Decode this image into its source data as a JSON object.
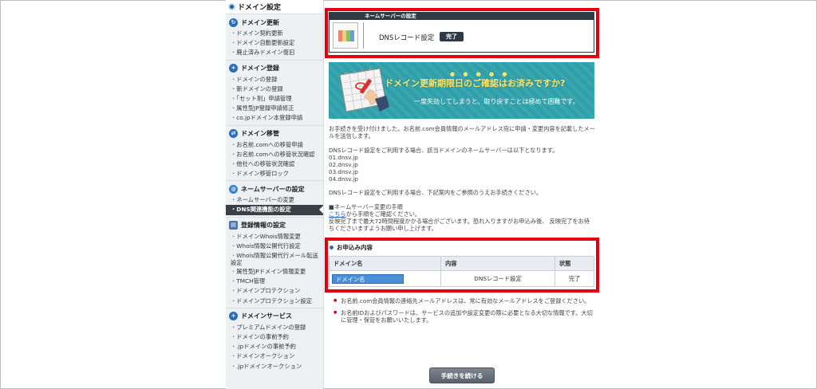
{
  "sidebar": {
    "title": "ドメイン設定",
    "sections": [
      {
        "name": "ドメイン更新",
        "items": [
          "ドメイン契約更新",
          "ドメイン自動更新設定",
          "廃止済みドメイン復旧"
        ]
      },
      {
        "name": "ドメイン登録",
        "items": [
          "ドメインの登録",
          "新ドメインの登録",
          "「セット割」申請管理",
          "属性型JP登録申請修正",
          "co.jpドメイン本登録申請"
        ]
      },
      {
        "name": "ドメイン移管",
        "items": [
          "お名前.comへの移管申請",
          "お名前.comへの移管状況確認",
          "他社への移管状況確認",
          "ドメイン移管ロック"
        ]
      },
      {
        "name": "ネームサーバーの設定",
        "items": [
          "ネームサーバーの変更",
          "DNS関連機能の設定"
        ]
      },
      {
        "name": "登録情報の設定",
        "items": [
          "ドメインWhois情報変更",
          "Whois情報公開代行設定",
          "Whois情報公開代行メール転送設定",
          "属性型JPドメイン情報変更",
          "TMCH管理",
          "ドメインプロテクション",
          "ドメインプロテクション設定"
        ]
      },
      {
        "name": "ドメインサービス",
        "items": [
          "プレミアムドメインの登録",
          "ドメインの事前予約",
          ".jpドメインの事前予約",
          "ドメインオークション",
          ".jpドメインオークション"
        ]
      }
    ]
  },
  "status_card": {
    "header": "ネームサーバーの設定",
    "label": "DNSレコード設定",
    "badge": "完了"
  },
  "banner": {
    "dots": "● ● ● ● ●",
    "title": "ドメイン更新期限日のご確認はお済みですか?",
    "subtitle": "一度失効してしまうと、取り戻すことは極めて困難です。"
  },
  "content": {
    "p1": "お手続きを受け付けました。お名前.com会員情報のメールアドレス宛に申請・変更内容を記載したメールを送信します。",
    "p2": "DNSレコード設定をご利用する場合、該当ドメインのネームサーバーは以下となります。",
    "nameservers": [
      "01.dnsv.jp",
      "02.dnsv.jp",
      "03.dnsv.jp",
      "04.dnsv.jp"
    ],
    "p3": "DNSレコード設定をご利用する場合、下記案内をご参照のうえお手続きください。",
    "ns_change_head": "■ネームサーバー変更の手順",
    "link_text": "こちら",
    "link_suffix": "から手順をご確認ください。",
    "p4": "反映完了まで最大72時間程度かかる場合がございます。恐れ入りますがお申込み後、 反映完了をお待ちくださいますようお願い申し上げます。"
  },
  "order": {
    "heading": "お申込み内容",
    "columns": [
      "ドメイン名",
      "内容",
      "状態"
    ],
    "rows": [
      {
        "domain": "ドメイン名",
        "content": "DNSレコード設定",
        "status": "完了"
      }
    ]
  },
  "notes": [
    "お名前.com会員情報の連絡先メールアドレスは、常に有効なメールアドレスをご登録ください。",
    "お名前IDおよびパスワードは、サービスの追加や設定変更の際に必要となる大切な情報です。大切に管理・保管をお願いいたします。"
  ],
  "buttons": {
    "continue": "手続きを続ける"
  },
  "colors": {
    "highlight": "#e0000f",
    "banner": "#2fa0a9",
    "banner_title": "#ffe66b",
    "active_item": "#3a3f45"
  }
}
